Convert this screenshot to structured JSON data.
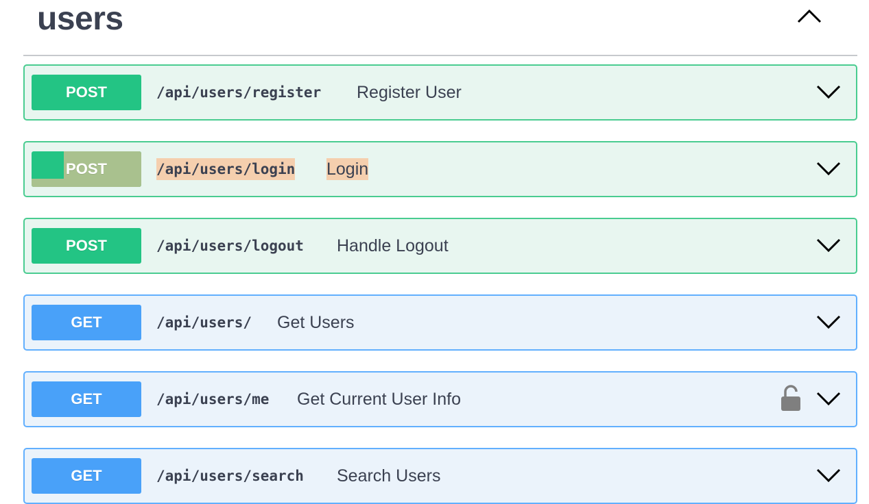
{
  "section": {
    "title": "users",
    "collapse_icon": "chevron-up-icon"
  },
  "operations": [
    {
      "method": "POST",
      "path": "/api/users/register",
      "summary": "Register User"
    },
    {
      "method": "POST",
      "path": "/api/users/login",
      "summary": "Login"
    },
    {
      "method": "POST",
      "path": "/api/users/logout",
      "summary": "Handle Logout"
    },
    {
      "method": "GET",
      "path": "/api/users/",
      "summary": "Get Users"
    },
    {
      "method": "GET",
      "path": "/api/users/me",
      "summary": "Get Current User Info",
      "lock_icon": "unlocked-lock-icon"
    },
    {
      "method": "GET",
      "path": "/api/users/search",
      "summary": "Search Users"
    }
  ],
  "colors": {
    "post_bg": "#e8f6f0",
    "post_border": "#49cc90",
    "post_method": "#23c484",
    "get_bg": "#ebf3fb",
    "get_border": "#61affe",
    "get_method": "#49a1f9",
    "text_selection": "#f5cfae"
  }
}
